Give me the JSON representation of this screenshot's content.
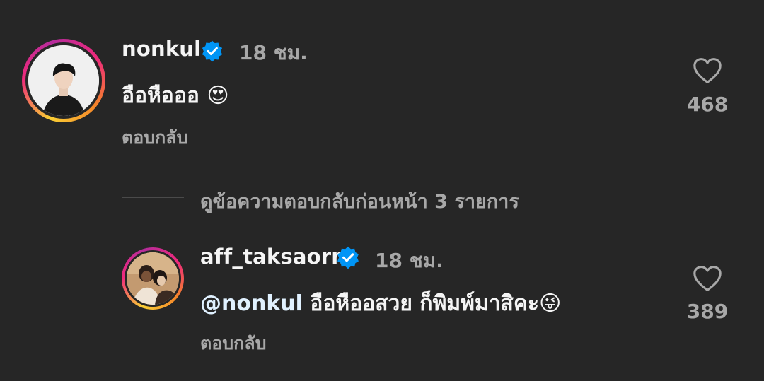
{
  "comments": [
    {
      "username": "nonkul",
      "verified": true,
      "time": "18 ชม.",
      "text": "อือหือออ",
      "emoji": "😍",
      "reply_label": "ตอบกลับ",
      "likes": "468",
      "avatar_icon": "profile-photo"
    },
    {
      "username": "aff_taksaorn",
      "verified": true,
      "time": "18 ชม.",
      "mention": "@nonkul",
      "text": "อือหืออสวย ก็พิมพ์มาสิคะ",
      "emoji": "😜",
      "reply_label": "ตอบกลับ",
      "likes": "389",
      "avatar_icon": "profile-photo"
    }
  ],
  "view_replies": "ดูข้อความตอบกลับก่อนหน้า 3 รายการ",
  "colors": {
    "background": "#262626",
    "primary_text": "#f5f5f5",
    "secondary_text": "#a8a8a8",
    "verified_badge": "#0095f6",
    "mention": "#e0f1ff"
  }
}
